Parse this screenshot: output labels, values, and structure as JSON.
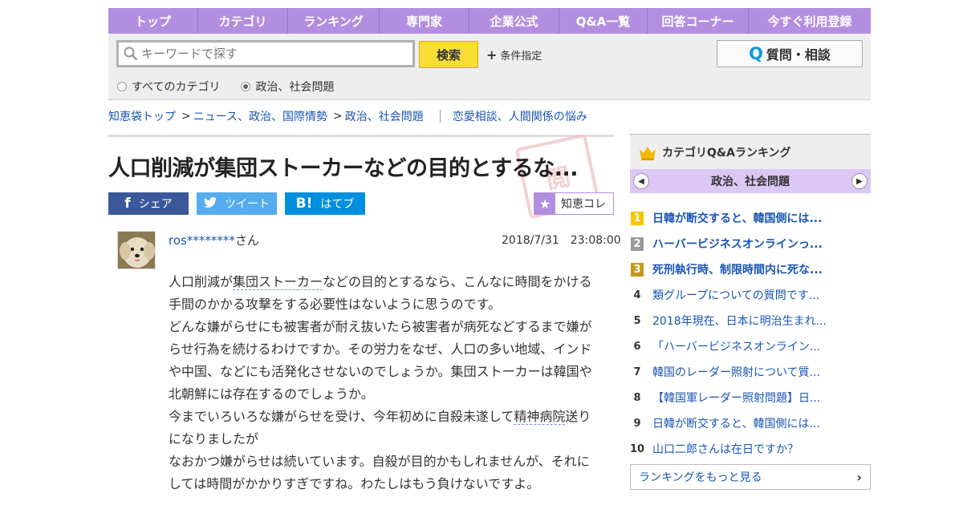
{
  "nav": [
    "トップ",
    "カテゴリ",
    "ランキング",
    "専門家",
    "企業公式",
    "Q&A一覧",
    "回答コーナー",
    "今すぐ利用登録"
  ],
  "search": {
    "placeholder": "キーワードで探す",
    "button": "検索",
    "conditions": "条件指定",
    "ask_button": "質問・相談",
    "radio_all": "すべてのカテゴリ",
    "radio_current": "政治、社会問題"
  },
  "breadcrumb": {
    "top": "知恵袋トップ",
    "level1": "ニュース、政治、国際情勢",
    "level2": "政治、社会問題",
    "related": "恋愛相談、人間関係の悩み"
  },
  "question": {
    "title": "人口削減が集団ストーカーなどの目的とするな...",
    "stamp": "閲",
    "share_fb": "シェア",
    "share_tw": "ツイート",
    "share_hb": "はてブ",
    "chie_coll": "知恵コレ",
    "user_name": "ros********",
    "user_suffix": "さん",
    "date": "2018/7/31　23:08:00",
    "p1_a": "人口削減が",
    "p1_kw": "集団ストーカー",
    "p1_b": "などの目的とするなら、こんなに時間をかける手間のかかる攻撃をする必要性はないように思うのです。",
    "p2": "どんな嫌がらせにも被害者が耐え抜いたら被害者が病死などするまで嫌がらせ行為を続けるわけですか。その労力をなぜ、人口の多い地域、インドや中国、などにも活発化させないのでしょうか。集団ストーカーは韓国や北朝鮮には存在するのでしょうか。",
    "p3_a": "今までいろいろな嫌がらせを受け、今年初めに自殺未遂して",
    "p3_kw": "精神病院",
    "p3_b": "送りになりましたが",
    "p4": "なおかつ嫌がらせは続いています。自殺が目的かもしれませんが、それにしては時間がかかりすぎですね。わたしはもう負けないですよ。"
  },
  "ranking": {
    "header": "カテゴリQ&Aランキング",
    "category": "政治、社会問題",
    "items": [
      {
        "num": "1",
        "text": "日韓が断交すると、韓国側には..."
      },
      {
        "num": "2",
        "text": "ハーバービジネスオンラインっ..."
      },
      {
        "num": "3",
        "text": "死刑執行時、制限時間内に死な..."
      },
      {
        "num": "4",
        "text": "類グループについての質問です..."
      },
      {
        "num": "5",
        "text": "2018年現在、日本に明治生まれ..."
      },
      {
        "num": "6",
        "text": "「ハーバービジネスオンライン..."
      },
      {
        "num": "7",
        "text": "韓国のレーダー照射について質..."
      },
      {
        "num": "8",
        "text": "【韓国軍レーダー照射問題】日..."
      },
      {
        "num": "9",
        "text": "日韓が断交すると、韓国側には..."
      },
      {
        "num": "10",
        "text": "山口二郎さんは在日ですか？"
      }
    ],
    "more": "ランキングをもっと見る"
  },
  "colors": {
    "nav": "#b38ee0",
    "link": "#1a55b5",
    "search_button": "#f8dd33"
  }
}
